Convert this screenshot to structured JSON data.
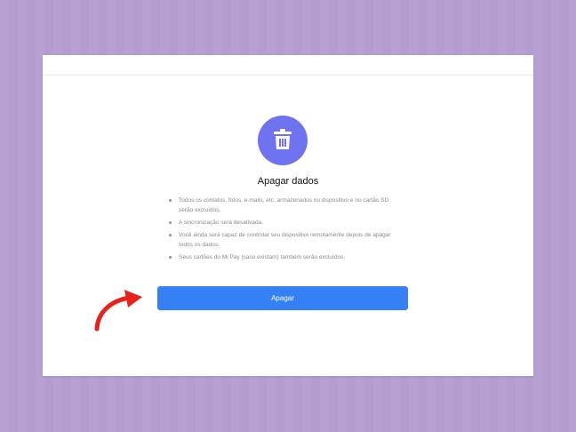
{
  "dialog": {
    "title": "Apagar dados",
    "icon": "trash-icon",
    "bullets": [
      "Todos os contatos, fotos, e-mails, etc. armazenados no dispositivo e no cartão SD serão excluídos.",
      "A sincronização será desativada.",
      "Você ainda será capaz de controlar seu dispositivo remotamente depois de apagar todos os dados.",
      "Seus cartões do Mi Pay (caso existam) também serão excluídos."
    ],
    "button_label": "Apagar"
  },
  "colors": {
    "background": "#b39cd0",
    "icon_circle": "#6f73f0",
    "button": "#3580f5",
    "arrow": "#e8211b"
  },
  "annotation": {
    "icon": "red-curved-arrow-icon"
  }
}
